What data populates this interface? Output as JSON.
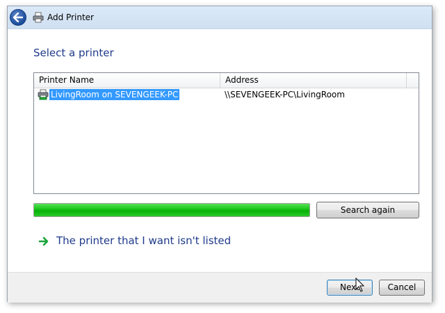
{
  "window": {
    "title": "Add Printer",
    "back_icon": "back-arrow-icon",
    "title_icon": "printer-icon"
  },
  "main": {
    "heading": "Select a printer",
    "list": {
      "columns": [
        "Printer Name",
        "Address"
      ],
      "rows": [
        {
          "icon": "network-printer-icon",
          "name": "LivingRoom on SEVENGEEK-PC",
          "address": "\\\\SEVENGEEK-PC\\LivingRoom",
          "selected": true
        }
      ]
    },
    "search_progress": 1.0,
    "search_again_label": "Search again",
    "not_listed_link": "The printer that I want isn't listed"
  },
  "footer": {
    "next_label": "Next",
    "cancel_label": "Cancel"
  },
  "colors": {
    "heading": "#1e3a8a",
    "selection": "#3399ff",
    "progress": "#17c317"
  }
}
